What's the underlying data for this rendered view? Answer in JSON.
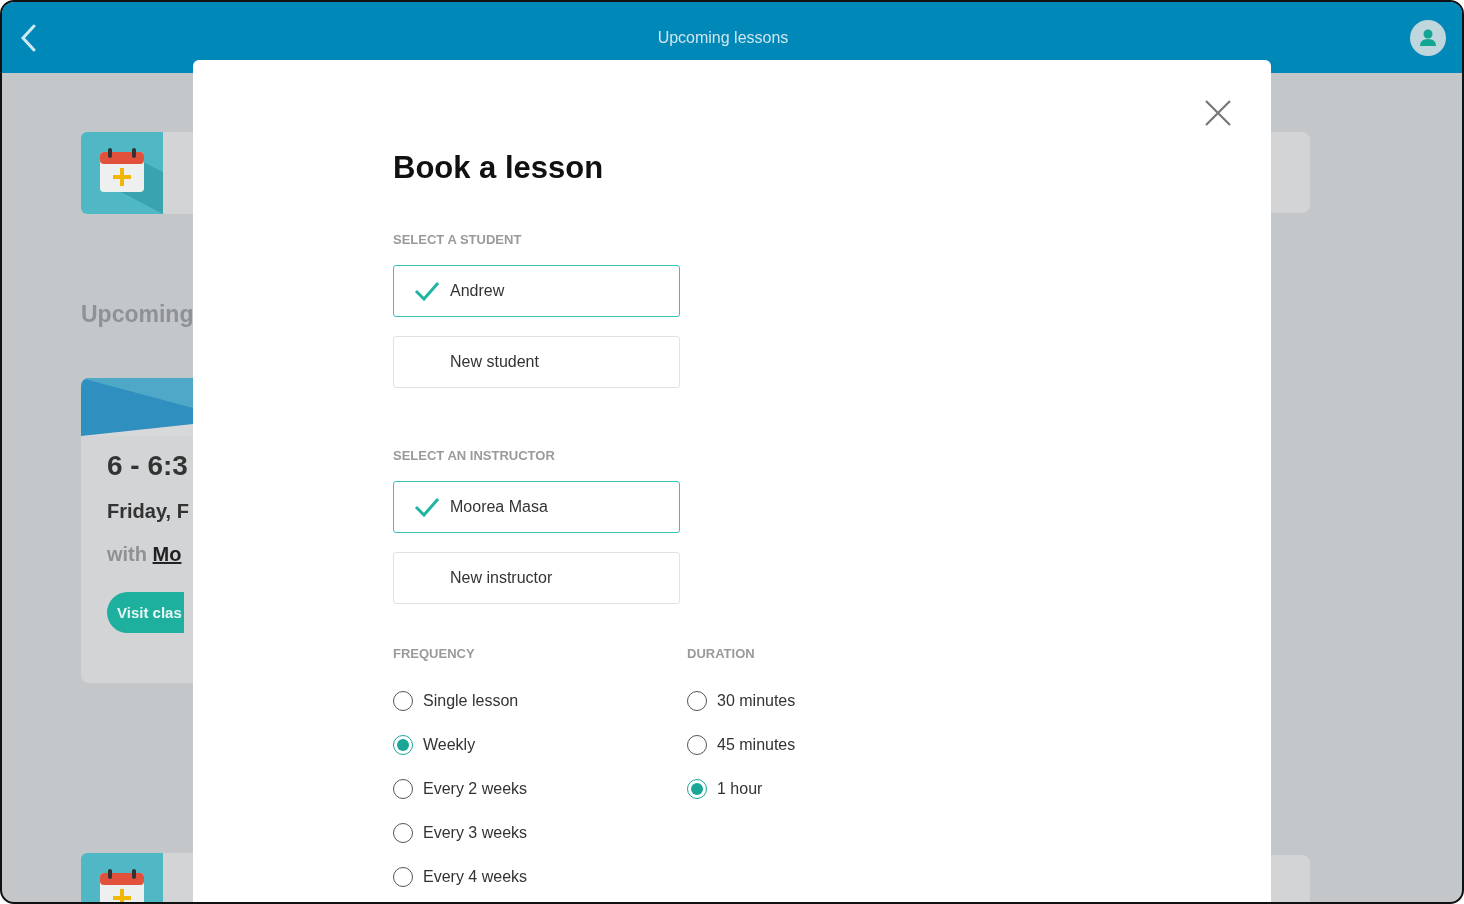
{
  "header": {
    "title": "Upcoming lessons"
  },
  "background": {
    "section_title": "Upcoming",
    "lesson_card": {
      "time": "6 - 6:3",
      "date": "Friday, F",
      "with": "with",
      "instructor": "Mo",
      "button": "Visit clas"
    }
  },
  "modal": {
    "title": "Book a lesson",
    "student": {
      "heading": "SELECT A STUDENT",
      "options": [
        {
          "label": "Andrew",
          "selected": true
        },
        {
          "label": "New student",
          "selected": false
        }
      ]
    },
    "instructor": {
      "heading": "SELECT AN INSTRUCTOR",
      "options": [
        {
          "label": "Moorea Masa",
          "selected": true
        },
        {
          "label": "New instructor",
          "selected": false
        }
      ]
    },
    "frequency": {
      "heading": "FREQUENCY",
      "options": [
        {
          "label": "Single lesson",
          "selected": false
        },
        {
          "label": "Weekly",
          "selected": true
        },
        {
          "label": "Every 2 weeks",
          "selected": false
        },
        {
          "label": "Every 3 weeks",
          "selected": false
        },
        {
          "label": "Every 4 weeks",
          "selected": false
        }
      ]
    },
    "duration": {
      "heading": "DURATION",
      "options": [
        {
          "label": "30 minutes",
          "selected": false
        },
        {
          "label": "45 minutes",
          "selected": false
        },
        {
          "label": "1 hour",
          "selected": true
        }
      ]
    }
  }
}
